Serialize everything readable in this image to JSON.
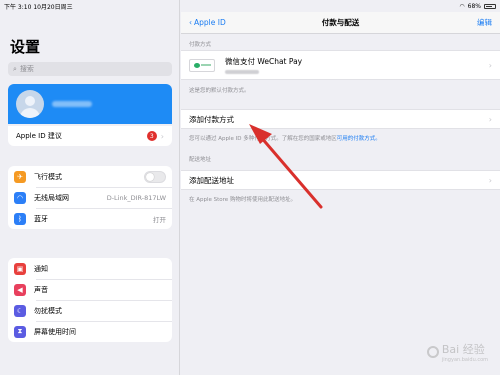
{
  "status": {
    "time": "下午 3:10",
    "date": "10月20日周三",
    "battery": "68%"
  },
  "sidebar": {
    "title": "设置",
    "search_placeholder": "搜索",
    "appleid_suggestion": "Apple ID 建议",
    "appleid_badge": "3",
    "group1": [
      {
        "label": "飞行模式",
        "icon": "airplane-icon",
        "color": "#f59a23",
        "value": ""
      },
      {
        "label": "无线局域网",
        "icon": "wifi-icon",
        "color": "#2c7ff7",
        "value": "D-Link_DIR-817LW"
      },
      {
        "label": "蓝牙",
        "icon": "bluetooth-icon",
        "color": "#2c7ff7",
        "value": "打开"
      }
    ],
    "group2": [
      {
        "label": "通知",
        "icon": "notification-icon",
        "color": "#e8403d"
      },
      {
        "label": "声音",
        "icon": "sound-icon",
        "color": "#e8405d"
      },
      {
        "label": "勿扰模式",
        "icon": "moon-icon",
        "color": "#5b5ce2"
      },
      {
        "label": "屏幕使用时间",
        "icon": "hourglass-icon",
        "color": "#5b5ce2"
      }
    ]
  },
  "detail": {
    "back_label": "Apple ID",
    "title": "付款与配送",
    "edit_label": "编辑",
    "payment_section": "付款方式",
    "wechat_pay": "微信支付 WeChat Pay",
    "default_note": "这是您的默认付款方式。",
    "add_payment": "添加付款方式",
    "payment_note": "您可以通过 Apple ID 多种付款方式。了解在您的国家或地区",
    "payment_note_link": "可用的付款方式。",
    "shipping_section": "配送地址",
    "add_shipping": "添加配送地址",
    "shipping_note": "在 Apple Store 购物时将使用此配送地址。"
  },
  "watermark": {
    "brand": "Bai 经验",
    "url": "jingyan.baidu.com"
  }
}
